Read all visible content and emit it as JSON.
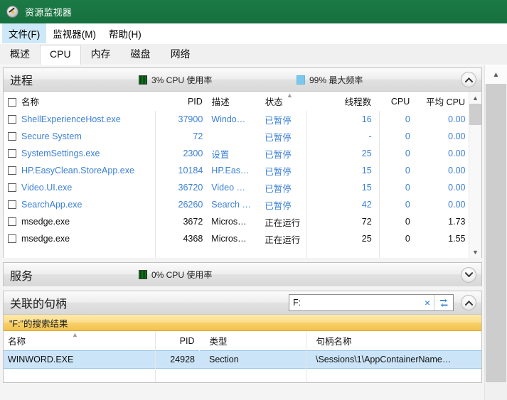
{
  "window": {
    "title": "资源监视器",
    "icon": "resource-monitor-icon"
  },
  "menubar": {
    "items": [
      {
        "label": "文件(F)",
        "selected": true
      },
      {
        "label": "监视器(M)",
        "selected": false
      },
      {
        "label": "帮助(H)",
        "selected": false
      }
    ]
  },
  "tabs": {
    "items": [
      {
        "label": "概述",
        "active": false
      },
      {
        "label": "CPU",
        "active": true
      },
      {
        "label": "内存",
        "active": false
      },
      {
        "label": "磁盘",
        "active": false
      },
      {
        "label": "网络",
        "active": false
      }
    ]
  },
  "processes_panel": {
    "title": "进程",
    "stats": [
      {
        "swatch": "green",
        "label": "3% CPU 使用率"
      },
      {
        "swatch": "blue",
        "label": "99% 最大频率"
      }
    ],
    "collapse_state": "expanded",
    "columns": [
      {
        "label": "名称",
        "align": "left"
      },
      {
        "label": "PID",
        "align": "right"
      },
      {
        "label": "描述",
        "align": "left"
      },
      {
        "label": "状态",
        "align": "left"
      },
      {
        "label": "线程数",
        "align": "right"
      },
      {
        "label": "CPU",
        "align": "right"
      },
      {
        "label": "平均 CPU",
        "align": "right"
      }
    ],
    "rows": [
      {
        "checked": false,
        "name": "ShellExperienceHost.exe",
        "pid": "37900",
        "desc": "Windo…",
        "status": "已暂停",
        "threads": "16",
        "cpu": "0",
        "avg_cpu": "0.00",
        "suspended": true
      },
      {
        "checked": false,
        "name": "Secure System",
        "pid": "72",
        "desc": "",
        "status": "已暂停",
        "threads": "-",
        "cpu": "0",
        "avg_cpu": "0.00",
        "suspended": true
      },
      {
        "checked": false,
        "name": "SystemSettings.exe",
        "pid": "2300",
        "desc": "设置",
        "status": "已暂停",
        "threads": "25",
        "cpu": "0",
        "avg_cpu": "0.00",
        "suspended": true
      },
      {
        "checked": false,
        "name": "HP.EasyClean.StoreApp.exe",
        "pid": "10184",
        "desc": "HP.Eas…",
        "status": "已暂停",
        "threads": "15",
        "cpu": "0",
        "avg_cpu": "0.00",
        "suspended": true
      },
      {
        "checked": false,
        "name": "Video.UI.exe",
        "pid": "36720",
        "desc": "Video …",
        "status": "已暂停",
        "threads": "15",
        "cpu": "0",
        "avg_cpu": "0.00",
        "suspended": true
      },
      {
        "checked": false,
        "name": "SearchApp.exe",
        "pid": "26260",
        "desc": "Search …",
        "status": "已暂停",
        "threads": "42",
        "cpu": "0",
        "avg_cpu": "0.00",
        "suspended": true
      },
      {
        "checked": false,
        "name": "msedge.exe",
        "pid": "3672",
        "desc": "Micros…",
        "status": "正在运行",
        "threads": "72",
        "cpu": "0",
        "avg_cpu": "1.73",
        "suspended": false
      },
      {
        "checked": false,
        "name": "msedge.exe",
        "pid": "4368",
        "desc": "Micros…",
        "status": "正在运行",
        "threads": "25",
        "cpu": "0",
        "avg_cpu": "1.55",
        "suspended": false
      }
    ]
  },
  "services_panel": {
    "title": "服务",
    "stats": [
      {
        "swatch": "green",
        "label": "0% CPU 使用率"
      }
    ],
    "collapse_state": "collapsed"
  },
  "handles_panel": {
    "title": "关联的句柄",
    "collapse_state": "expanded",
    "search": {
      "value": "F:",
      "placeholder": "搜索句柄",
      "clear_label": "×",
      "search_icon": "search-handles-icon"
    },
    "result_banner": "\"F:\"的搜索结果",
    "columns": [
      {
        "label": "名称",
        "align": "left"
      },
      {
        "label": "PID",
        "align": "right"
      },
      {
        "label": "类型",
        "align": "left"
      },
      {
        "label": "句柄名称",
        "align": "left"
      }
    ],
    "rows": [
      {
        "name": "WINWORD.EXE",
        "pid": "24928",
        "type": "Section",
        "handle_name": "\\Sessions\\1\\AppContainerName…",
        "selected": true
      }
    ]
  },
  "colors": {
    "titlebar": "#16703f",
    "accent_link": "#3a7fd5",
    "selection": "#cce4f7",
    "banner": "#f7d06a",
    "menu_highlight": "#cde8f7"
  }
}
